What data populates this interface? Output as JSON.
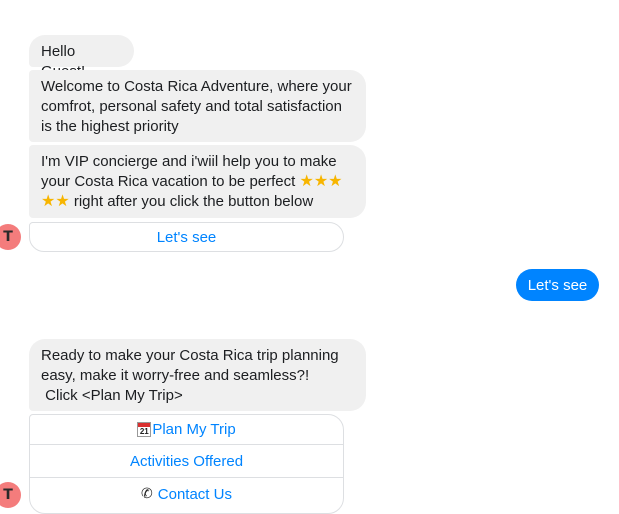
{
  "bot": {
    "avatar_letter": "T",
    "messages": [
      "Hello Guest!",
      "Welcome to Costa Rica Adventure, where your comfrot, personal safety and total satisfaction is the highest priority",
      "I'm VIP concierge and i'wiil help you to make your Costa Rica vacation to be perfect",
      "right after you click the button below"
    ],
    "quick_reply_1": "Let's see",
    "message_2_line1": "Ready to make your Costa Rica trip planning easy, make it worry-free and seamless?!",
    "message_2_line2": " Click <Plan My Trip>",
    "calendar_day": "21",
    "buttons": [
      "Plan My Trip",
      "Activities Offered",
      "Contact Us"
    ]
  },
  "user": {
    "reply": "Let's see"
  },
  "colors": {
    "accent": "#0084ff",
    "bubble_bg": "#f0f0f0",
    "avatar_bg": "#f47c7c"
  },
  "icons": [
    "star-icon",
    "calendar-icon",
    "phone-icon"
  ]
}
